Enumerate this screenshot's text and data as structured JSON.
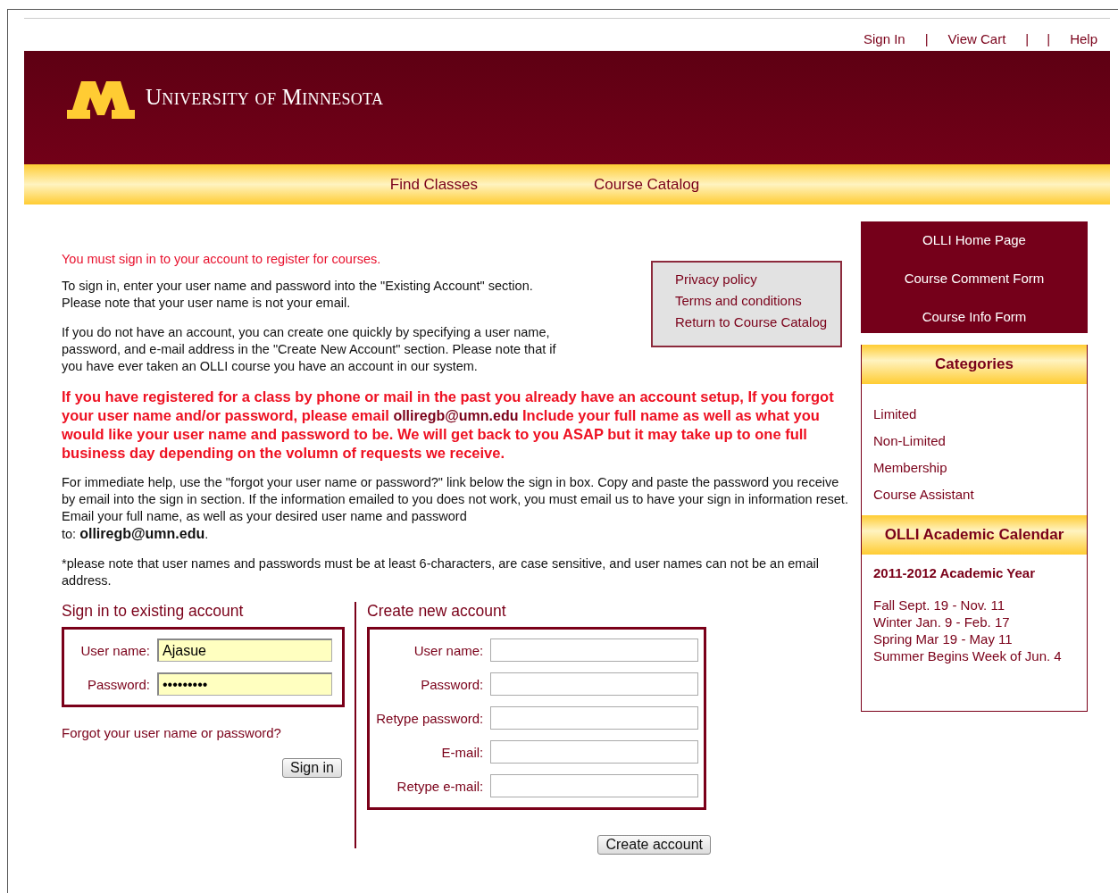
{
  "top_links": [
    {
      "kind": "link",
      "label": "Sign In"
    },
    {
      "kind": "separator",
      "label": "|"
    },
    {
      "kind": "link",
      "label": "View Cart"
    },
    {
      "kind": "separator",
      "label": "|"
    },
    {
      "kind": "separator",
      "label": "|"
    },
    {
      "kind": "link",
      "label": "Help"
    }
  ],
  "header": {
    "wordmark": "University of Minnesota"
  },
  "nav": [
    "Find Classes",
    "Course Catalog"
  ],
  "notice": "You must sign in to your account to register for courses.",
  "paragraphs": [
    {
      "kind": "plain",
      "text": "To sign in, enter your user name and password into the \"Existing Account\" section.\nPlease note that your user name is not your email."
    },
    {
      "kind": "plain",
      "text": "If you do not have an account, you can create one quickly by specifying a user name,\npassword, and e-mail address in the \"Create New Account\" section. Please note that if\nyou have ever taken an OLLI course you have an account in our system."
    },
    {
      "kind": "alert",
      "text": "If you have registered for a class by phone or mail in the past you already have an account setup, If you forgot your user name and/or password, please email **olliregb@umn.edu** Include your full name as well as what you would like your user name and password to be. We will get back to you ASAP but it may take up to one full business day depending on the volumn of requests we receive."
    },
    {
      "kind": "plain",
      "text": "For immediate help, use the \"forgot your user name or password?\" link below the sign in box. Copy and paste the password you receive by email into the sign in section. If the information emailed to you does not work, you must email us to have your sign in information reset. Email your full name, as well as your desired user name and password\nto: **olliregb@umn.edu**."
    },
    {
      "kind": "plain",
      "text": "*please note that user names and passwords must be at least 6-characters, are case sensitive, and user names can not be an email address."
    }
  ],
  "policy_links": [
    "Privacy policy",
    "Terms and conditions",
    "Return to Course Catalog"
  ],
  "sign_in": {
    "title": "Sign in to existing account",
    "fields": [
      {
        "label": "User name:",
        "value": "Ajasue"
      },
      {
        "label": "Password:",
        "value": "•••••••••"
      }
    ],
    "forgot_link": "Forgot your user name or password?",
    "button": "Sign in"
  },
  "create": {
    "title": "Create new account",
    "fields": [
      {
        "label": "User name:"
      },
      {
        "label": "Password:"
      },
      {
        "label": "Retype password:"
      },
      {
        "label": "E-mail:"
      },
      {
        "label": "Retype e-mail:"
      }
    ],
    "button": "Create account"
  },
  "sidebar": {
    "links": [
      "OLLI Home Page",
      "Course Comment Form",
      "Course Info Form"
    ],
    "categories": {
      "title": "Categories",
      "items": [
        "Limited",
        "Non-Limited",
        "Membership",
        "Course Assistant"
      ]
    },
    "calendar": {
      "title": "OLLI Academic Calendar",
      "year": "2011-2012 Academic Year",
      "terms": [
        "Fall Sept. 19 - Nov. 11",
        "Winter Jan. 9 - Feb. 17",
        "Spring Mar 19 - May 11",
        "Summer Begins Week of Jun. 4"
      ]
    }
  }
}
